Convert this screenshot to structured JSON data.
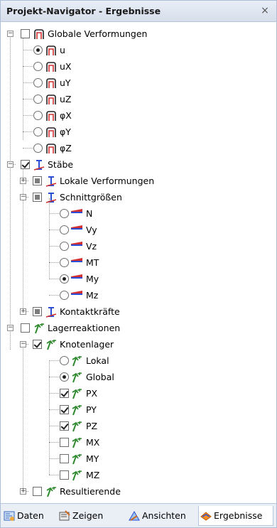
{
  "panel": {
    "title": "Projekt-Navigator - Ergebnisse",
    "close_glyph": "×"
  },
  "tree": {
    "global": {
      "label": "Globale Verformungen",
      "items": [
        "u",
        "uX",
        "uY",
        "uZ",
        "φX",
        "φY",
        "φZ"
      ],
      "selected": "u"
    },
    "staebe": {
      "label": "Stäbe",
      "lokale": "Lokale Verformungen",
      "schnitt": {
        "label": "Schnittgrößen",
        "items": [
          "N",
          "Vy",
          "Vz",
          "MT",
          "My",
          "Mz"
        ],
        "selected": "My"
      },
      "kontakt": "Kontaktkräfte"
    },
    "lager": {
      "label": "Lagerreaktionen",
      "knoten": {
        "label": "Knotenlager",
        "radios": [
          "Lokal",
          "Global"
        ],
        "selected": "Global",
        "checks": [
          {
            "label": "PX",
            "checked": true
          },
          {
            "label": "PY",
            "checked": true
          },
          {
            "label": "PZ",
            "checked": true
          },
          {
            "label": "MX",
            "checked": false
          },
          {
            "label": "MY",
            "checked": false
          },
          {
            "label": "MZ",
            "checked": false
          }
        ]
      },
      "resultierende": "Resultierende"
    }
  },
  "tabs": {
    "daten": "Daten",
    "zeigen": "Zeigen",
    "ansichten": "Ansichten",
    "ergebnisse": "Ergebnisse",
    "active": "ergebnisse"
  },
  "colors": {
    "accent_blue": "#2a4fd6",
    "accent_red": "#d23030",
    "support_green": "#2f8a2f"
  }
}
